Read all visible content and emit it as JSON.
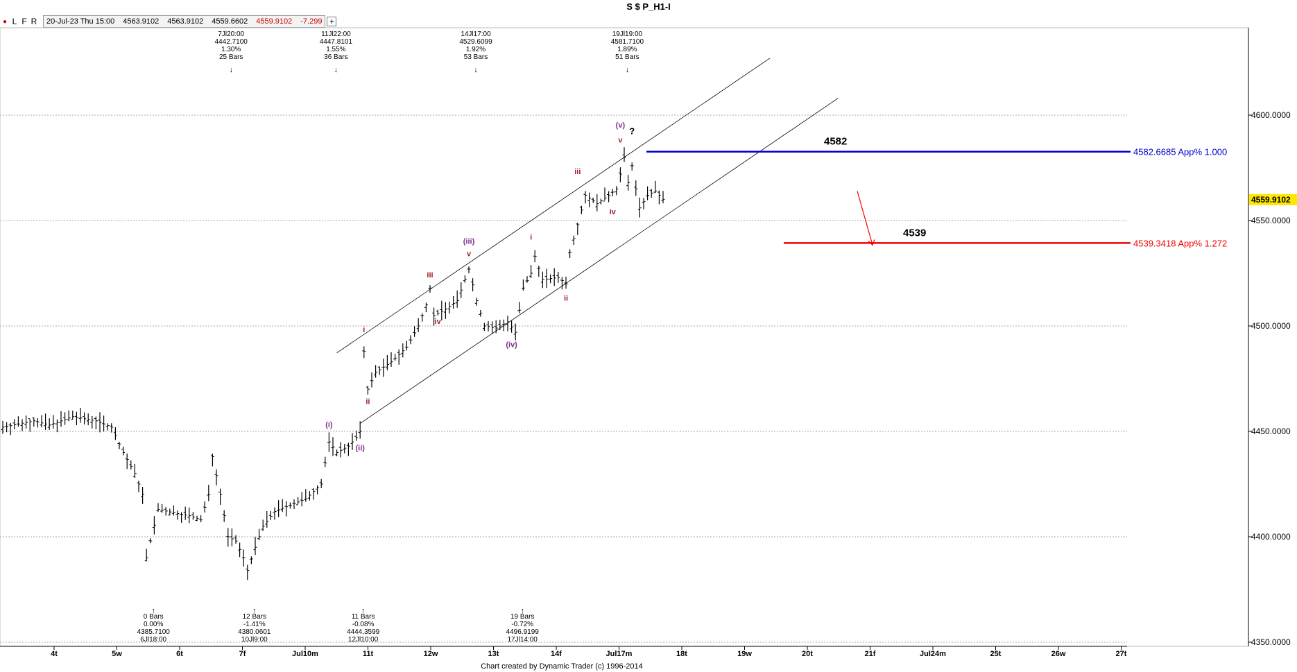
{
  "window": {
    "title": "S $ P_H1-I"
  },
  "toolbar": {
    "buttons": [
      {
        "label": "●",
        "icon": "record-dot-icon"
      },
      {
        "label": "L"
      },
      {
        "label": "F"
      },
      {
        "label": "R"
      }
    ],
    "info": {
      "datetime": "20-Jul-23 Thu 15:00",
      "open": "4563.9102",
      "high": "4563.9102",
      "low": "4559.6602",
      "close": "4559.9102",
      "change": "-7.299",
      "plus_label": "+"
    }
  },
  "footer": {
    "credit": "Chart created by Dynamic Trader  (c)  1996-2014"
  },
  "chart_data": {
    "type": "candlestick",
    "title": "S $ P_H1-I",
    "ylim": [
      4350,
      4650
    ],
    "y_ticks": [
      {
        "value": 4350,
        "label": "4350.0000"
      },
      {
        "value": 4400,
        "label": "4400.0000"
      },
      {
        "value": 4450,
        "label": "4450.0000"
      },
      {
        "value": 4500,
        "label": "4500.0000"
      },
      {
        "value": 4550,
        "label": "4550.0000"
      },
      {
        "value": 4600,
        "label": "4600.0000"
      }
    ],
    "grid": true,
    "x_ticks": [
      "4t",
      "5w",
      "6t",
      "7f",
      "Jul10m",
      "11t",
      "12w",
      "13t",
      "14f",
      "Jul17m",
      "18t",
      "19w",
      "20t",
      "21f",
      "Jul24m",
      "25t",
      "26w",
      "27t"
    ],
    "last_price": {
      "value": 4559.9102,
      "label": "4559.9102",
      "color": "#ffe800"
    },
    "price_path": [
      {
        "bar": 0,
        "price": 4452
      },
      {
        "bar": 8,
        "price": 4455
      },
      {
        "bar": 12,
        "price": 4453
      },
      {
        "bar": 18,
        "price": 4457
      },
      {
        "bar": 24,
        "price": 4455
      },
      {
        "bar": 28,
        "price": 4452
      },
      {
        "bar": 31,
        "price": 4440
      },
      {
        "bar": 34,
        "price": 4430
      },
      {
        "bar": 36,
        "price": 4420
      },
      {
        "bar": 37,
        "price": 4390
      },
      {
        "bar": 38,
        "price": 4398
      },
      {
        "bar": 40,
        "price": 4413
      },
      {
        "bar": 45,
        "price": 4411
      },
      {
        "bar": 48,
        "price": 4410
      },
      {
        "bar": 51,
        "price": 4408
      },
      {
        "bar": 53,
        "price": 4420
      },
      {
        "bar": 54,
        "price": 4438
      },
      {
        "bar": 56,
        "price": 4420
      },
      {
        "bar": 58,
        "price": 4400
      },
      {
        "bar": 60,
        "price": 4398
      },
      {
        "bar": 62,
        "price": 4390
      },
      {
        "bar": 63,
        "price": 4384
      },
      {
        "bar": 65,
        "price": 4395
      },
      {
        "bar": 67,
        "price": 4405
      },
      {
        "bar": 70,
        "price": 4412
      },
      {
        "bar": 74,
        "price": 4415
      },
      {
        "bar": 78,
        "price": 4418
      },
      {
        "bar": 82,
        "price": 4425
      },
      {
        "bar": 84,
        "price": 4445
      },
      {
        "bar": 86,
        "price": 4440
      },
      {
        "bar": 89,
        "price": 4443
      },
      {
        "bar": 91,
        "price": 4447
      },
      {
        "bar": 92,
        "price": 4450
      },
      {
        "bar": 93,
        "price": 4488
      },
      {
        "bar": 94,
        "price": 4470
      },
      {
        "bar": 96,
        "price": 4478
      },
      {
        "bar": 100,
        "price": 4483
      },
      {
        "bar": 104,
        "price": 4490
      },
      {
        "bar": 107,
        "price": 4500
      },
      {
        "bar": 109,
        "price": 4510
      },
      {
        "bar": 110,
        "price": 4518
      },
      {
        "bar": 111,
        "price": 4505
      },
      {
        "bar": 114,
        "price": 4508
      },
      {
        "bar": 117,
        "price": 4512
      },
      {
        "bar": 119,
        "price": 4522
      },
      {
        "bar": 120,
        "price": 4527
      },
      {
        "bar": 122,
        "price": 4512
      },
      {
        "bar": 124,
        "price": 4500
      },
      {
        "bar": 127,
        "price": 4499
      },
      {
        "bar": 130,
        "price": 4502
      },
      {
        "bar": 132,
        "price": 4497
      },
      {
        "bar": 134,
        "price": 4518
      },
      {
        "bar": 136,
        "price": 4525
      },
      {
        "bar": 137,
        "price": 4533
      },
      {
        "bar": 139,
        "price": 4522
      },
      {
        "bar": 143,
        "price": 4523
      },
      {
        "bar": 145,
        "price": 4520
      },
      {
        "bar": 146,
        "price": 4535
      },
      {
        "bar": 148,
        "price": 4548
      },
      {
        "bar": 150,
        "price": 4562
      },
      {
        "bar": 153,
        "price": 4558
      },
      {
        "bar": 156,
        "price": 4562
      },
      {
        "bar": 158,
        "price": 4565
      },
      {
        "bar": 159,
        "price": 4572
      },
      {
        "bar": 160,
        "price": 4580
      },
      {
        "bar": 161,
        "price": 4568
      },
      {
        "bar": 162,
        "price": 4576
      },
      {
        "bar": 163,
        "price": 4565
      },
      {
        "bar": 164,
        "price": 4556
      },
      {
        "bar": 166,
        "price": 4562
      },
      {
        "bar": 168,
        "price": 4564
      },
      {
        "bar": 170,
        "price": 4560
      }
    ],
    "horizontal_levels": [
      {
        "value": 4582.6685,
        "label": "4582.6685 App% 1.000",
        "short_label": "4582",
        "color": "#0000cc"
      },
      {
        "value": 4539.3418,
        "label": "4539.3418 App% 1.272",
        "short_label": "4539",
        "color": "#ee0000"
      }
    ],
    "channel": {
      "upper": [
        {
          "bar": 89,
          "price": 4491
        },
        {
          "bar": 160,
          "price": 4580
        }
      ],
      "parallel_offset": -41
    },
    "wave_labels": [
      {
        "text": "(i)",
        "bar": 84,
        "price": 4452,
        "color": "#7b2c8c"
      },
      {
        "text": "(ii)",
        "bar": 92,
        "price": 4441,
        "color": "#7b2c8c"
      },
      {
        "text": "i",
        "bar": 93,
        "price": 4497,
        "color": "#9b1c2c"
      },
      {
        "text": "ii",
        "bar": 94,
        "price": 4463,
        "color": "#9b1c2c"
      },
      {
        "text": "iii",
        "bar": 110,
        "price": 4523,
        "color": "#9b1c2c"
      },
      {
        "text": "iv",
        "bar": 112,
        "price": 4501,
        "color": "#9b1c2c"
      },
      {
        "text": "(iii)",
        "bar": 120,
        "price": 4539,
        "color": "#7b2c8c"
      },
      {
        "text": "v",
        "bar": 120,
        "price": 4533,
        "color": "#9b1c2c"
      },
      {
        "text": "(iv)",
        "bar": 131,
        "price": 4490,
        "color": "#7b2c8c"
      },
      {
        "text": "i",
        "bar": 136,
        "price": 4541,
        "color": "#9b1c2c"
      },
      {
        "text": "ii",
        "bar": 145,
        "price": 4512,
        "color": "#9b1c2c"
      },
      {
        "text": "iii",
        "bar": 148,
        "price": 4572,
        "color": "#9b1c2c"
      },
      {
        "text": "iv",
        "bar": 157,
        "price": 4553,
        "color": "#9b1c2c"
      },
      {
        "text": "(v)",
        "bar": 159,
        "price": 4594,
        "color": "#7b2c8c"
      },
      {
        "text": "v",
        "bar": 159,
        "price": 4587,
        "color": "#9b1c2c"
      },
      {
        "text": "?",
        "bar": 162,
        "price": 4591,
        "color": "#000000"
      }
    ],
    "pivot_annotations": [
      {
        "bar": 57,
        "position": "top",
        "lines": [
          "7Jl20:00",
          "4442.7100",
          "1.30%",
          "25 Bars"
        ]
      },
      {
        "bar": 84,
        "position": "top",
        "lines": [
          "11Jl22:00",
          "4447.8101",
          "1.55%",
          "36 Bars"
        ]
      },
      {
        "bar": 120,
        "position": "top",
        "lines": [
          "14Jl17:00",
          "4529.6099",
          "1.92%",
          "53 Bars"
        ]
      },
      {
        "bar": 159,
        "position": "top",
        "lines": [
          "19Jl19:00",
          "4581.7100",
          "1.89%",
          "51 Bars"
        ]
      },
      {
        "bar": 37,
        "position": "bottom",
        "lines": [
          "0 Bars",
          "0.00%",
          "4385.7100",
          "6Jl18:00"
        ]
      },
      {
        "bar": 63,
        "position": "bottom",
        "lines": [
          "12 Bars",
          "-1.41%",
          "4380.0601",
          "10Jl9:00"
        ]
      },
      {
        "bar": 91,
        "position": "bottom",
        "lines": [
          "11 Bars",
          "-0.08%",
          "4444.3599",
          "12Jl10:00"
        ]
      },
      {
        "bar": 132,
        "position": "bottom",
        "lines": [
          "19 Bars",
          "-0.72%",
          "4496.9199",
          "17Jl14:00"
        ]
      }
    ],
    "projection_arrow": {
      "from_bar": 173,
      "from_price": 4562,
      "to_bar": 176,
      "to_price": 4541,
      "color": "#ee0000"
    }
  }
}
